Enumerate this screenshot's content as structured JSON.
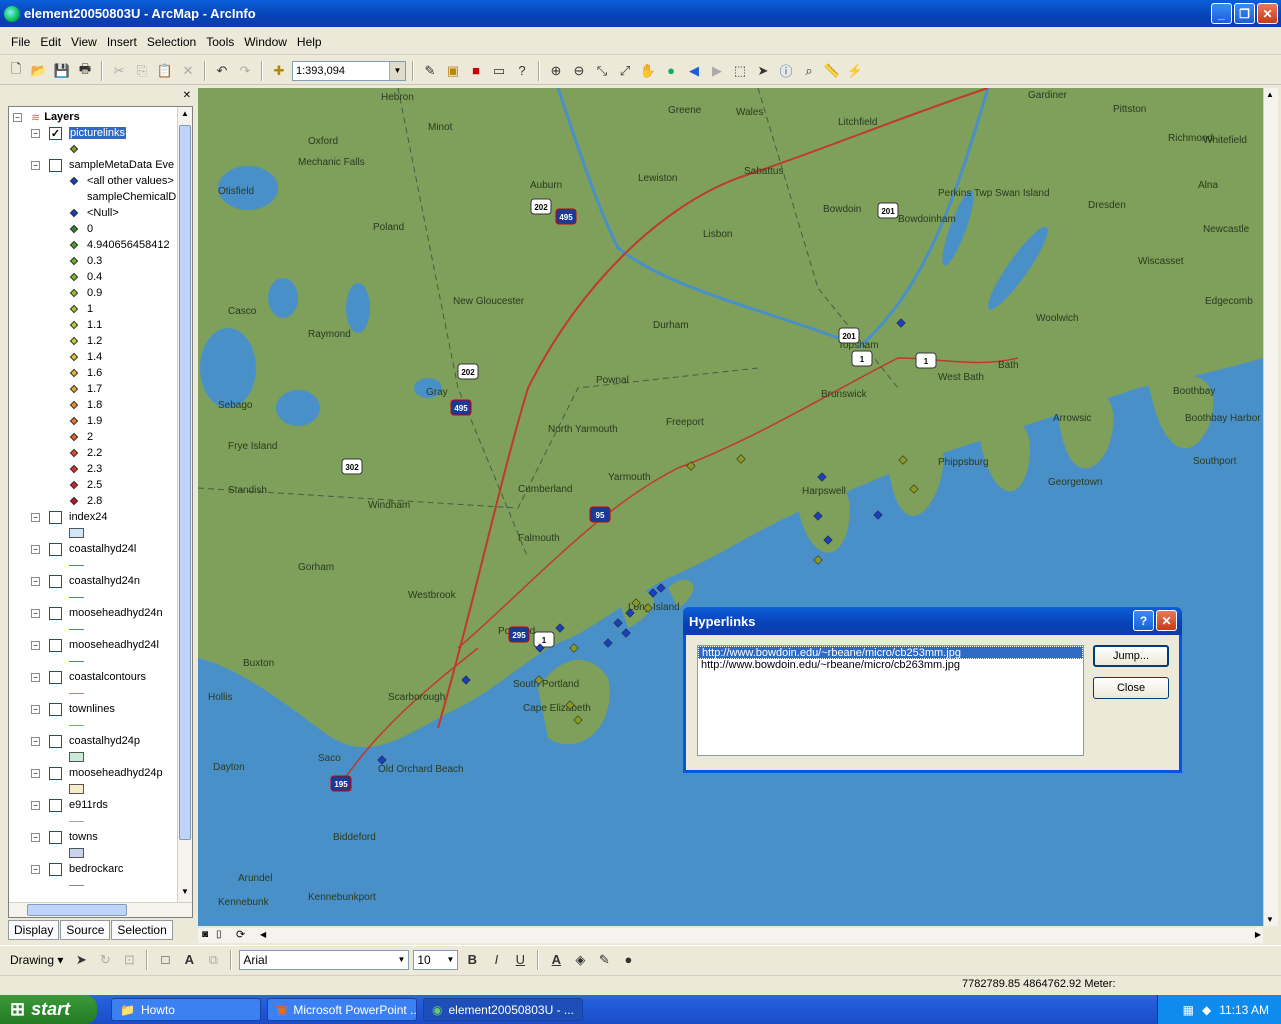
{
  "window": {
    "title": "element20050803U - ArcMap - ArcInfo"
  },
  "menu": [
    "File",
    "Edit",
    "View",
    "Insert",
    "Selection",
    "Tools",
    "Window",
    "Help"
  ],
  "toolbar": {
    "scale": "1:393,094"
  },
  "toc": {
    "root": "Layers",
    "layers": [
      {
        "name": "picturelinks",
        "checked": true,
        "selected": true
      },
      {
        "name": "sampleMetaData Eve",
        "checked": false
      },
      {
        "name": "index24",
        "checked": false
      },
      {
        "name": "coastalhyd24l",
        "checked": false
      },
      {
        "name": "coastalhyd24n",
        "checked": false
      },
      {
        "name": "mooseheadhyd24n",
        "checked": false
      },
      {
        "name": "mooseheadhyd24l",
        "checked": false
      },
      {
        "name": "coastalcontours",
        "checked": false
      },
      {
        "name": "townlines",
        "checked": false
      },
      {
        "name": "coastalhyd24p",
        "checked": false
      },
      {
        "name": "mooseheadhyd24p",
        "checked": false
      },
      {
        "name": "e911rds",
        "checked": false
      },
      {
        "name": "towns",
        "checked": false
      },
      {
        "name": "bedrockarc",
        "checked": false
      }
    ],
    "classes": [
      "<all other values>",
      "sampleChemicalD",
      "<Null>",
      "0",
      "4.940656458412",
      "0.3",
      "0.4",
      "0.9",
      "1",
      "1.1",
      "1.2",
      "1.4",
      "1.6",
      "1.7",
      "1.8",
      "1.9",
      "2",
      "2.2",
      "2.3",
      "2.5",
      "2.8"
    ],
    "tabs": [
      "Display",
      "Source",
      "Selection"
    ]
  },
  "map": {
    "towns": [
      "Hebron",
      "Minot",
      "Oxford",
      "Mechanic Falls",
      "Auburn",
      "Lewiston",
      "Greene",
      "Wales",
      "Litchfield",
      "Pittston",
      "Whitefield",
      "Otisfield",
      "Sabattus",
      "Gardiner",
      "Richmond",
      "Alna",
      "Poland",
      "Lisbon",
      "Bowdoin",
      "Bowdoinham",
      "Perkins Twp Swan Island",
      "Dresden",
      "Wiscasset",
      "Newcastle",
      "Casco",
      "Raymond",
      "New Gloucester",
      "Durham",
      "Topsham",
      "Woolwich",
      "Edgecomb",
      "Gray",
      "Pownal",
      "Brunswick",
      "West Bath",
      "Bath",
      "Boothbay",
      "Sebago",
      "Frye Island",
      "North Yarmouth",
      "Freeport",
      "Arrowsic",
      "Boothbay Harbor",
      "Standish",
      "Cumberland",
      "Yarmouth",
      "Harpswell",
      "Phippsburg",
      "Georgetown",
      "Southport",
      "Windham",
      "Falmouth",
      "Gorham",
      "Westbrook",
      "Portland",
      "Long Island",
      "Buxton",
      "South Portland",
      "Scarborough",
      "Cape Elizabeth",
      "Hollis",
      "Dayton",
      "Saco",
      "Old Orchard Beach",
      "Biddeford",
      "Arundel",
      "Kennebunk",
      "Kennebunkport"
    ],
    "shields": [
      "202",
      "495",
      "202",
      "495",
      "302",
      "95",
      "295",
      "1",
      "195",
      "201",
      "201",
      "1",
      "1"
    ]
  },
  "dialog": {
    "title": "Hyperlinks",
    "links": [
      "http://www.bowdoin.edu/~rbeane/micro/cb253mm.jpg",
      "http://www.bowdoin.edu/~rbeane/micro/cb263mm.jpg"
    ],
    "jump": "Jump...",
    "close": "Close"
  },
  "drawing": {
    "label": "Drawing",
    "font": "Arial",
    "size": "10"
  },
  "status": {
    "coords": "7782789.85  4864762.92 Meter:"
  },
  "taskbar": {
    "start": "start",
    "tasks": [
      "Howto",
      "Microsoft PowerPoint ...",
      "element20050803U - ..."
    ],
    "clock": "11:13 AM"
  }
}
